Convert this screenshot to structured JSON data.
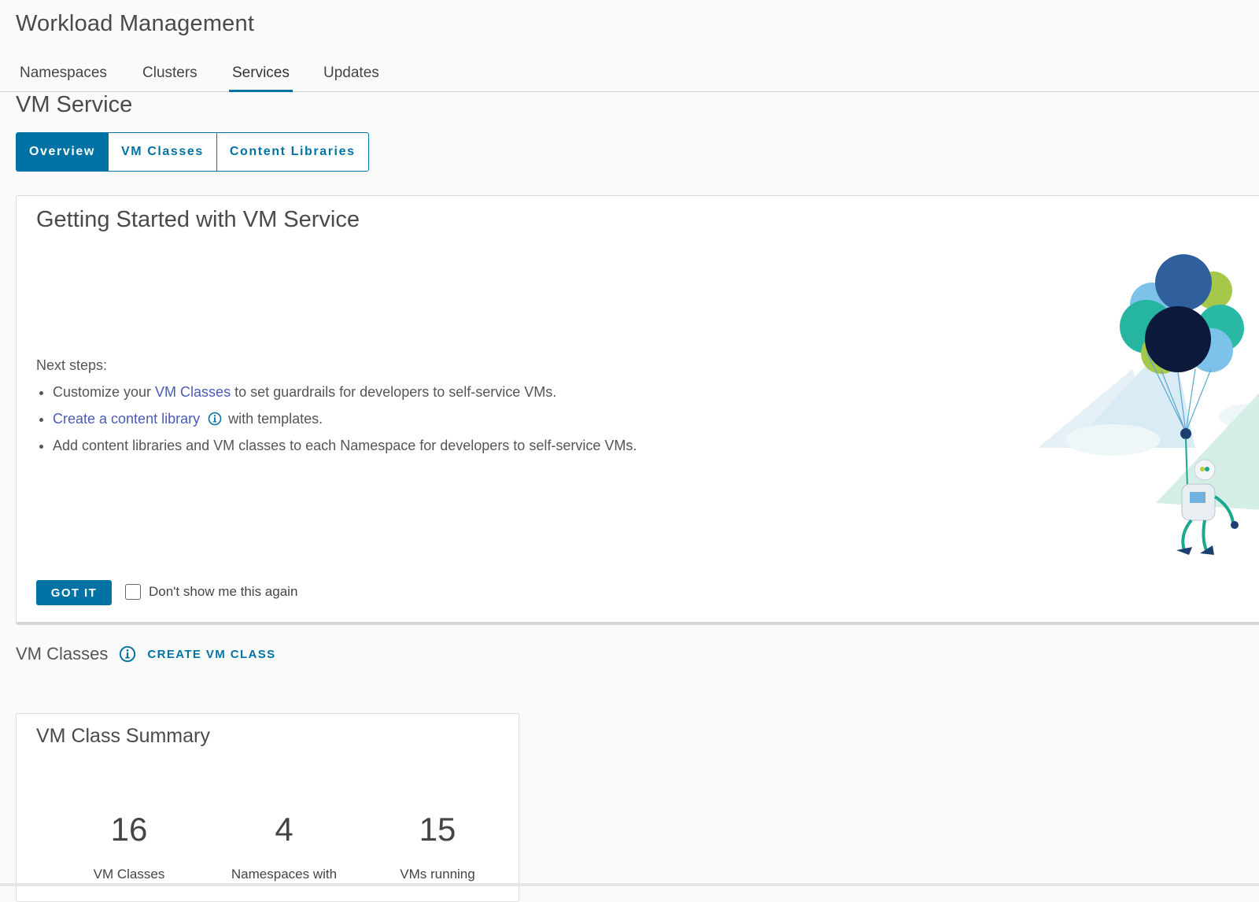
{
  "page": {
    "title": "Workload Management"
  },
  "tabs": [
    {
      "label": "Namespaces",
      "active": false
    },
    {
      "label": "Clusters",
      "active": false
    },
    {
      "label": "Services",
      "active": true
    },
    {
      "label": "Updates",
      "active": false
    }
  ],
  "service": {
    "title": "VM Service",
    "segments": [
      {
        "label": "Overview",
        "active": true
      },
      {
        "label": "VM Classes",
        "active": false
      },
      {
        "label": "Content Libraries",
        "active": false
      }
    ]
  },
  "getting_started": {
    "title": "Getting Started with VM Service",
    "next_steps_label": "Next steps:",
    "step1": {
      "prefix": "Customize your ",
      "link": "VM Classes",
      "suffix": " to set guardrails for developers to self-service VMs."
    },
    "step2": {
      "link": "Create a content library",
      "suffix": "with templates."
    },
    "step3": {
      "text": "Add content libraries and VM classes to each Namespace for developers to self-service VMs."
    },
    "got_it_label": "GOT IT",
    "dont_show_label": "Don't show me this again",
    "dont_show_checked": false,
    "illustration_icon": "balloons-robot-illustration"
  },
  "vm_classes": {
    "title": "VM Classes",
    "create_label": "CREATE VM CLASS",
    "summary": {
      "title": "VM Class Summary",
      "stats": [
        {
          "value": "16",
          "label": "VM Classes"
        },
        {
          "value": "4",
          "label": "Namespaces with"
        },
        {
          "value": "15",
          "label": "VMs running"
        }
      ]
    }
  },
  "colors": {
    "accent": "#0072a3",
    "link": "#4a5bb8",
    "background": "#fafafa"
  }
}
